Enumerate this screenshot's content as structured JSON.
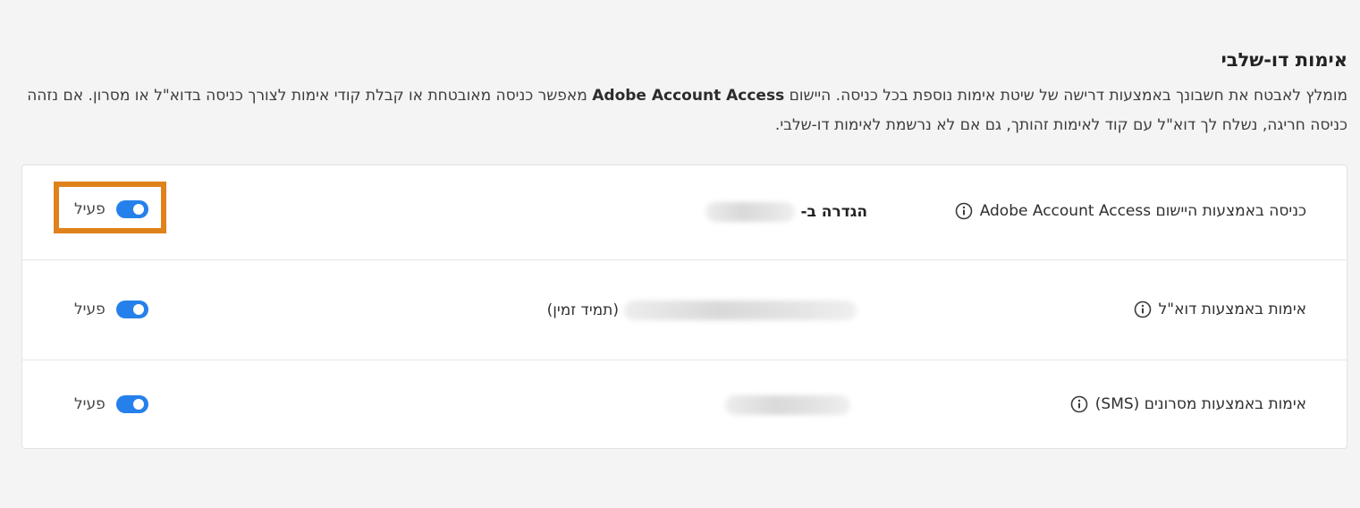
{
  "section": {
    "title": "אימות דו-שלבי",
    "description_part1": "מומלץ לאבטח את חשבונך באמצעות דרישה של שיטת אימות נוספת בכל כניסה. היישום ",
    "description_brand": "Adobe Account Access",
    "description_part2": " מאפשר כניסה מאובטחת או קבלת קודי אימות לצורך כניסה בדוא\"ל או מסרון. אם נזהה כניסה חריגה, נשלח לך דוא\"ל עם קוד לאימות זהותך, גם אם לא נרשמת לאימות דו-שלבי."
  },
  "methods": [
    {
      "label": "כניסה באמצעות היישום Adobe Account Access",
      "detail_label": "הגדרה ב-",
      "detail_value_blurred": true,
      "toggle_label": "פעיל",
      "enabled": true,
      "highlighted": true
    },
    {
      "label": "אימות באמצעות דוא\"ל",
      "detail_label": "(תמיד זמין)",
      "detail_value_blurred": true,
      "toggle_label": "פעיל",
      "enabled": true,
      "highlighted": false
    },
    {
      "label": "אימות באמצעות מסרונים (SMS)",
      "detail_label": "",
      "detail_value_blurred": true,
      "toggle_label": "פעיל",
      "enabled": true,
      "highlighted": false
    }
  ],
  "colors": {
    "toggle_on": "#2680eb",
    "highlight": "#e0821b",
    "page_bg": "#f4f4f4"
  },
  "icons": {
    "info": "info-icon"
  }
}
